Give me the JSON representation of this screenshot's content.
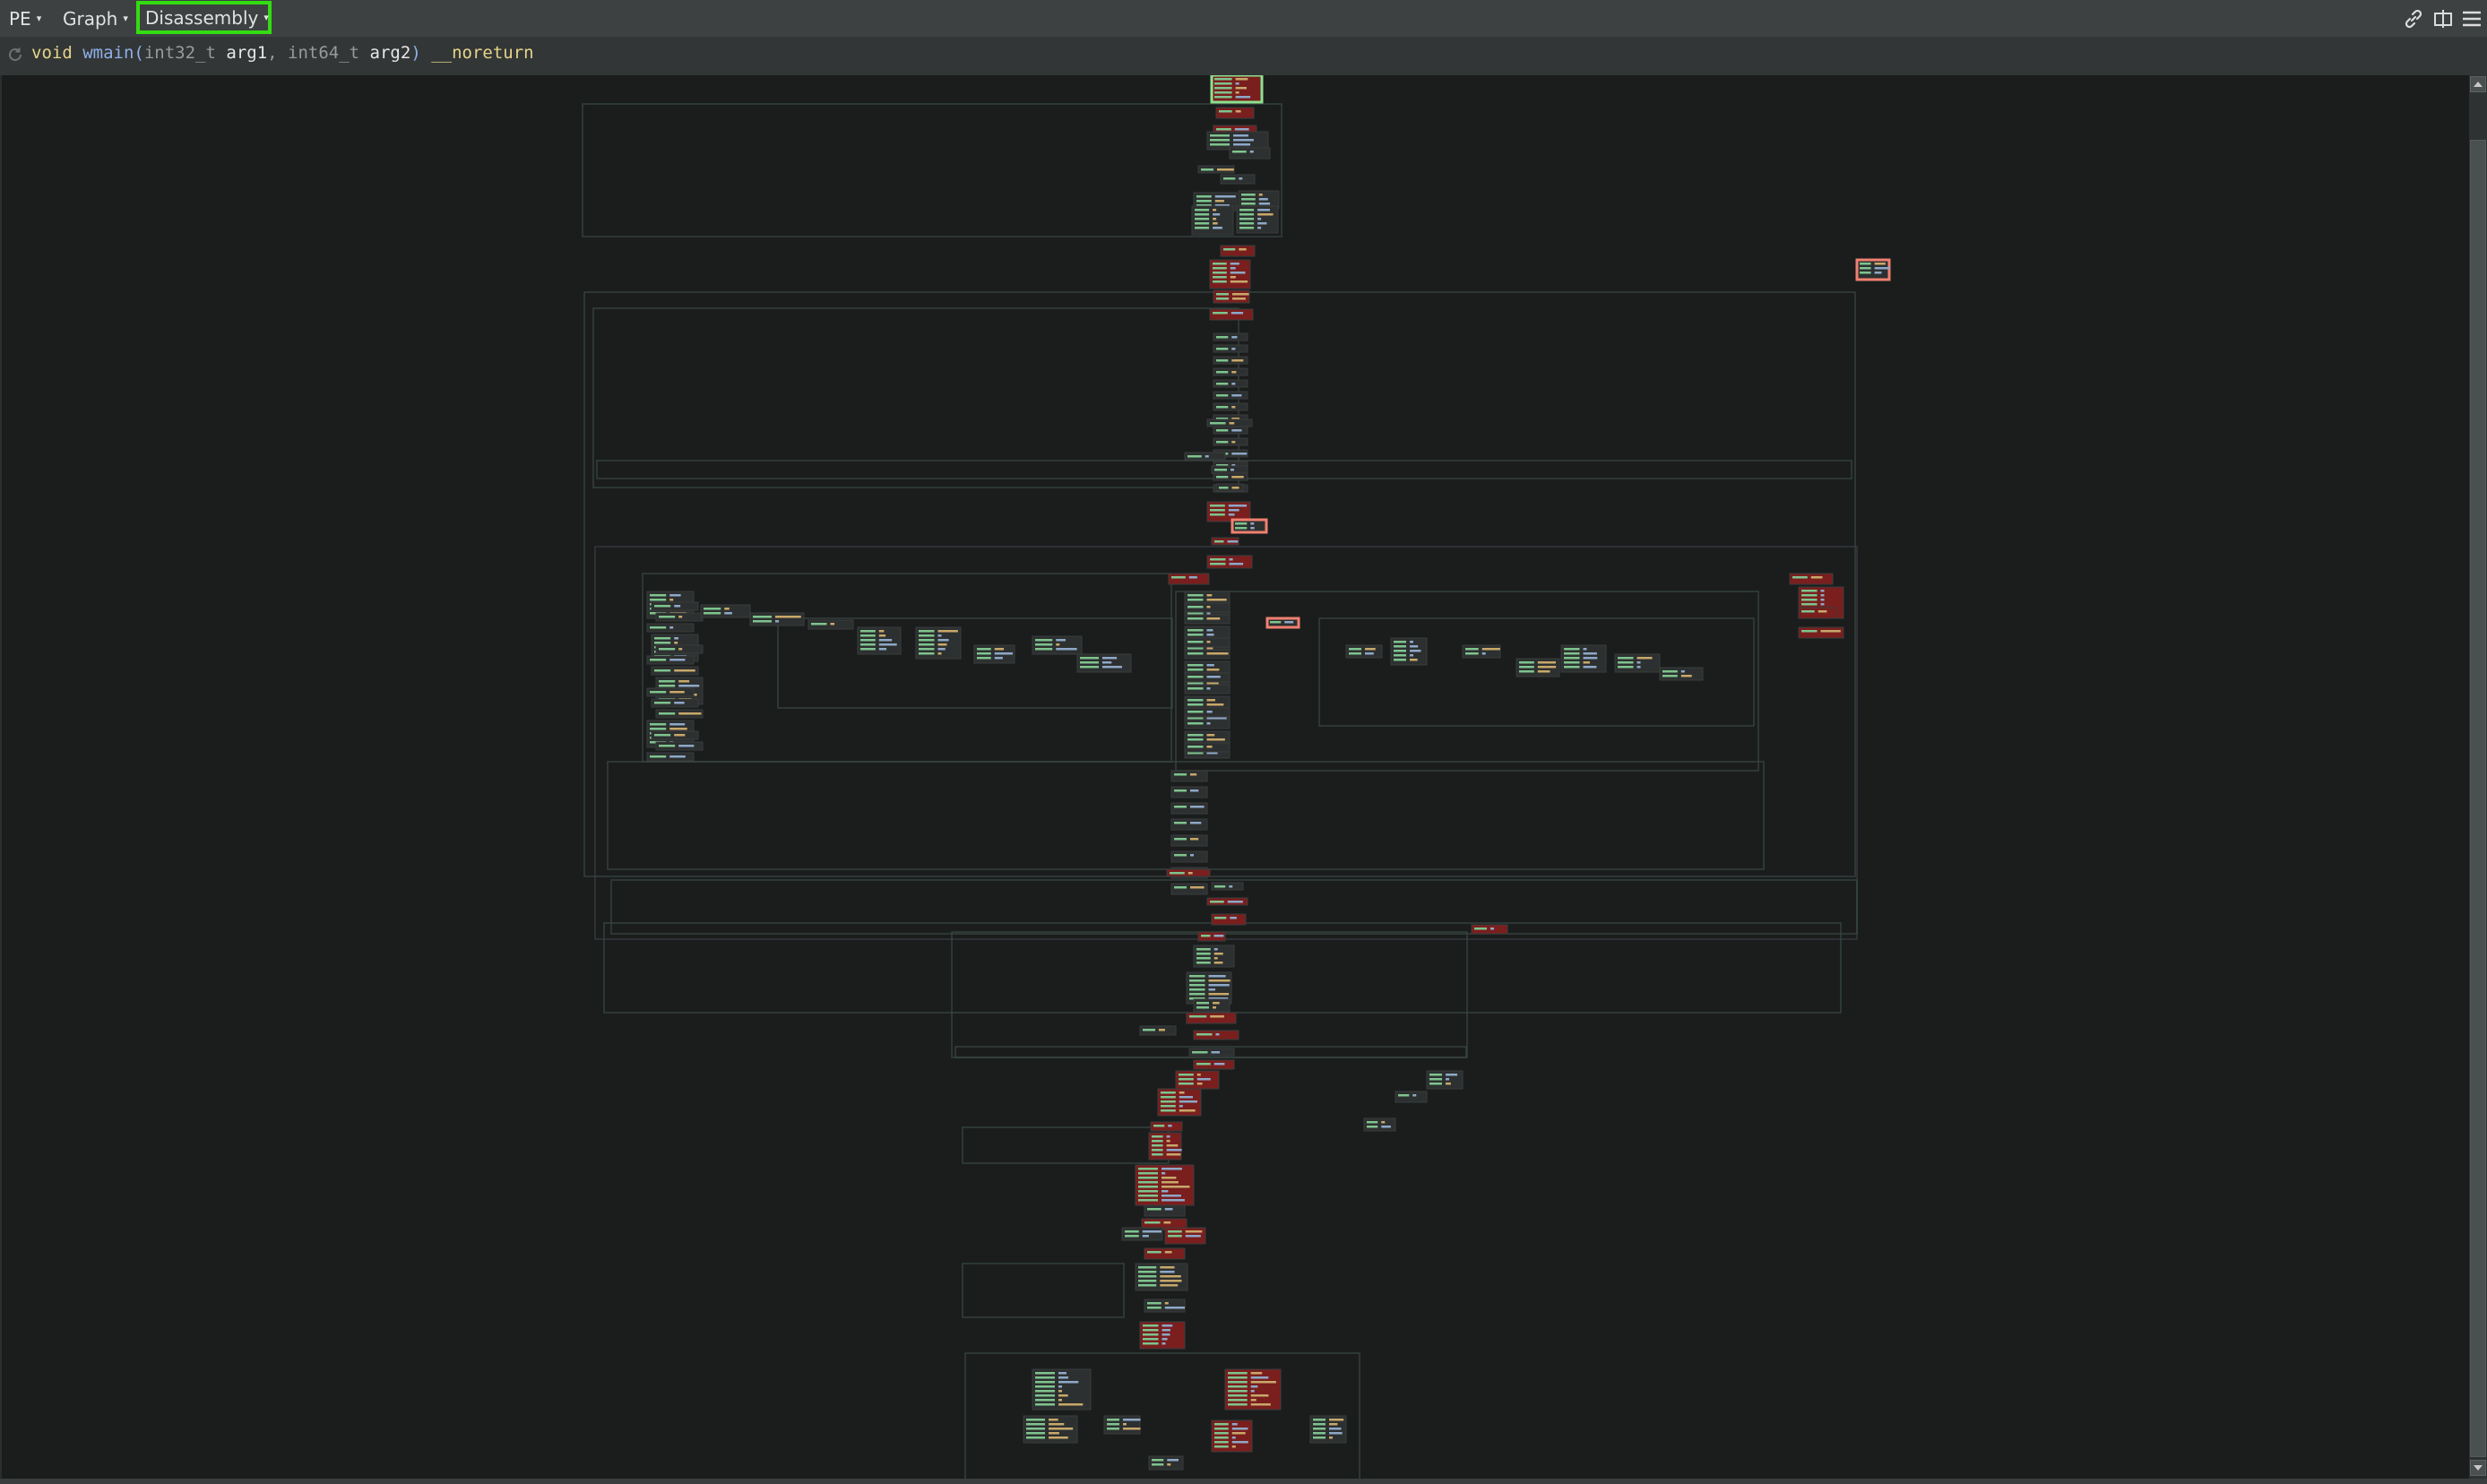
{
  "toolbar": {
    "menus": [
      {
        "label": "PE",
        "arrow": "▾"
      },
      {
        "label": "Graph",
        "arrow": "▾"
      },
      {
        "label": "Disassembly",
        "arrow": "▾",
        "highlighted": true
      }
    ],
    "right_icons": [
      "link-icon",
      "split-view-icon",
      "hamburger-menu-icon"
    ],
    "highlight_color": "#33dd11"
  },
  "signature": {
    "icon": "refresh-icon",
    "tokens": [
      {
        "text": "void ",
        "color": "#e6d48a"
      },
      {
        "text": "wmain",
        "color": "#8fb0e8"
      },
      {
        "text": "(",
        "color": "#8fb0e8"
      },
      {
        "text": "int32_t ",
        "color": "#9a9a9a"
      },
      {
        "text": "arg1",
        "color": "#e8e8e8"
      },
      {
        "text": ", ",
        "color": "#9a9a9a"
      },
      {
        "text": "int64_t ",
        "color": "#9a9a9a"
      },
      {
        "text": "arg2",
        "color": "#e8e8e8"
      },
      {
        "text": ")",
        "color": "#8fb0e8"
      },
      {
        "text": " __noreturn",
        "color": "#e6d48a"
      }
    ]
  },
  "graph": {
    "view": "Disassembly graph (zoomed out)",
    "colors": {
      "normal_block": "#2d3030",
      "highlighted_block": "#7a1e1e",
      "selected_border": "#8ee08e",
      "current_border": "#f08070",
      "edge": "#3a4a44",
      "text_green": "#7ec48e"
    }
  },
  "scrollbar": {
    "up": "▲",
    "down": "▼"
  }
}
